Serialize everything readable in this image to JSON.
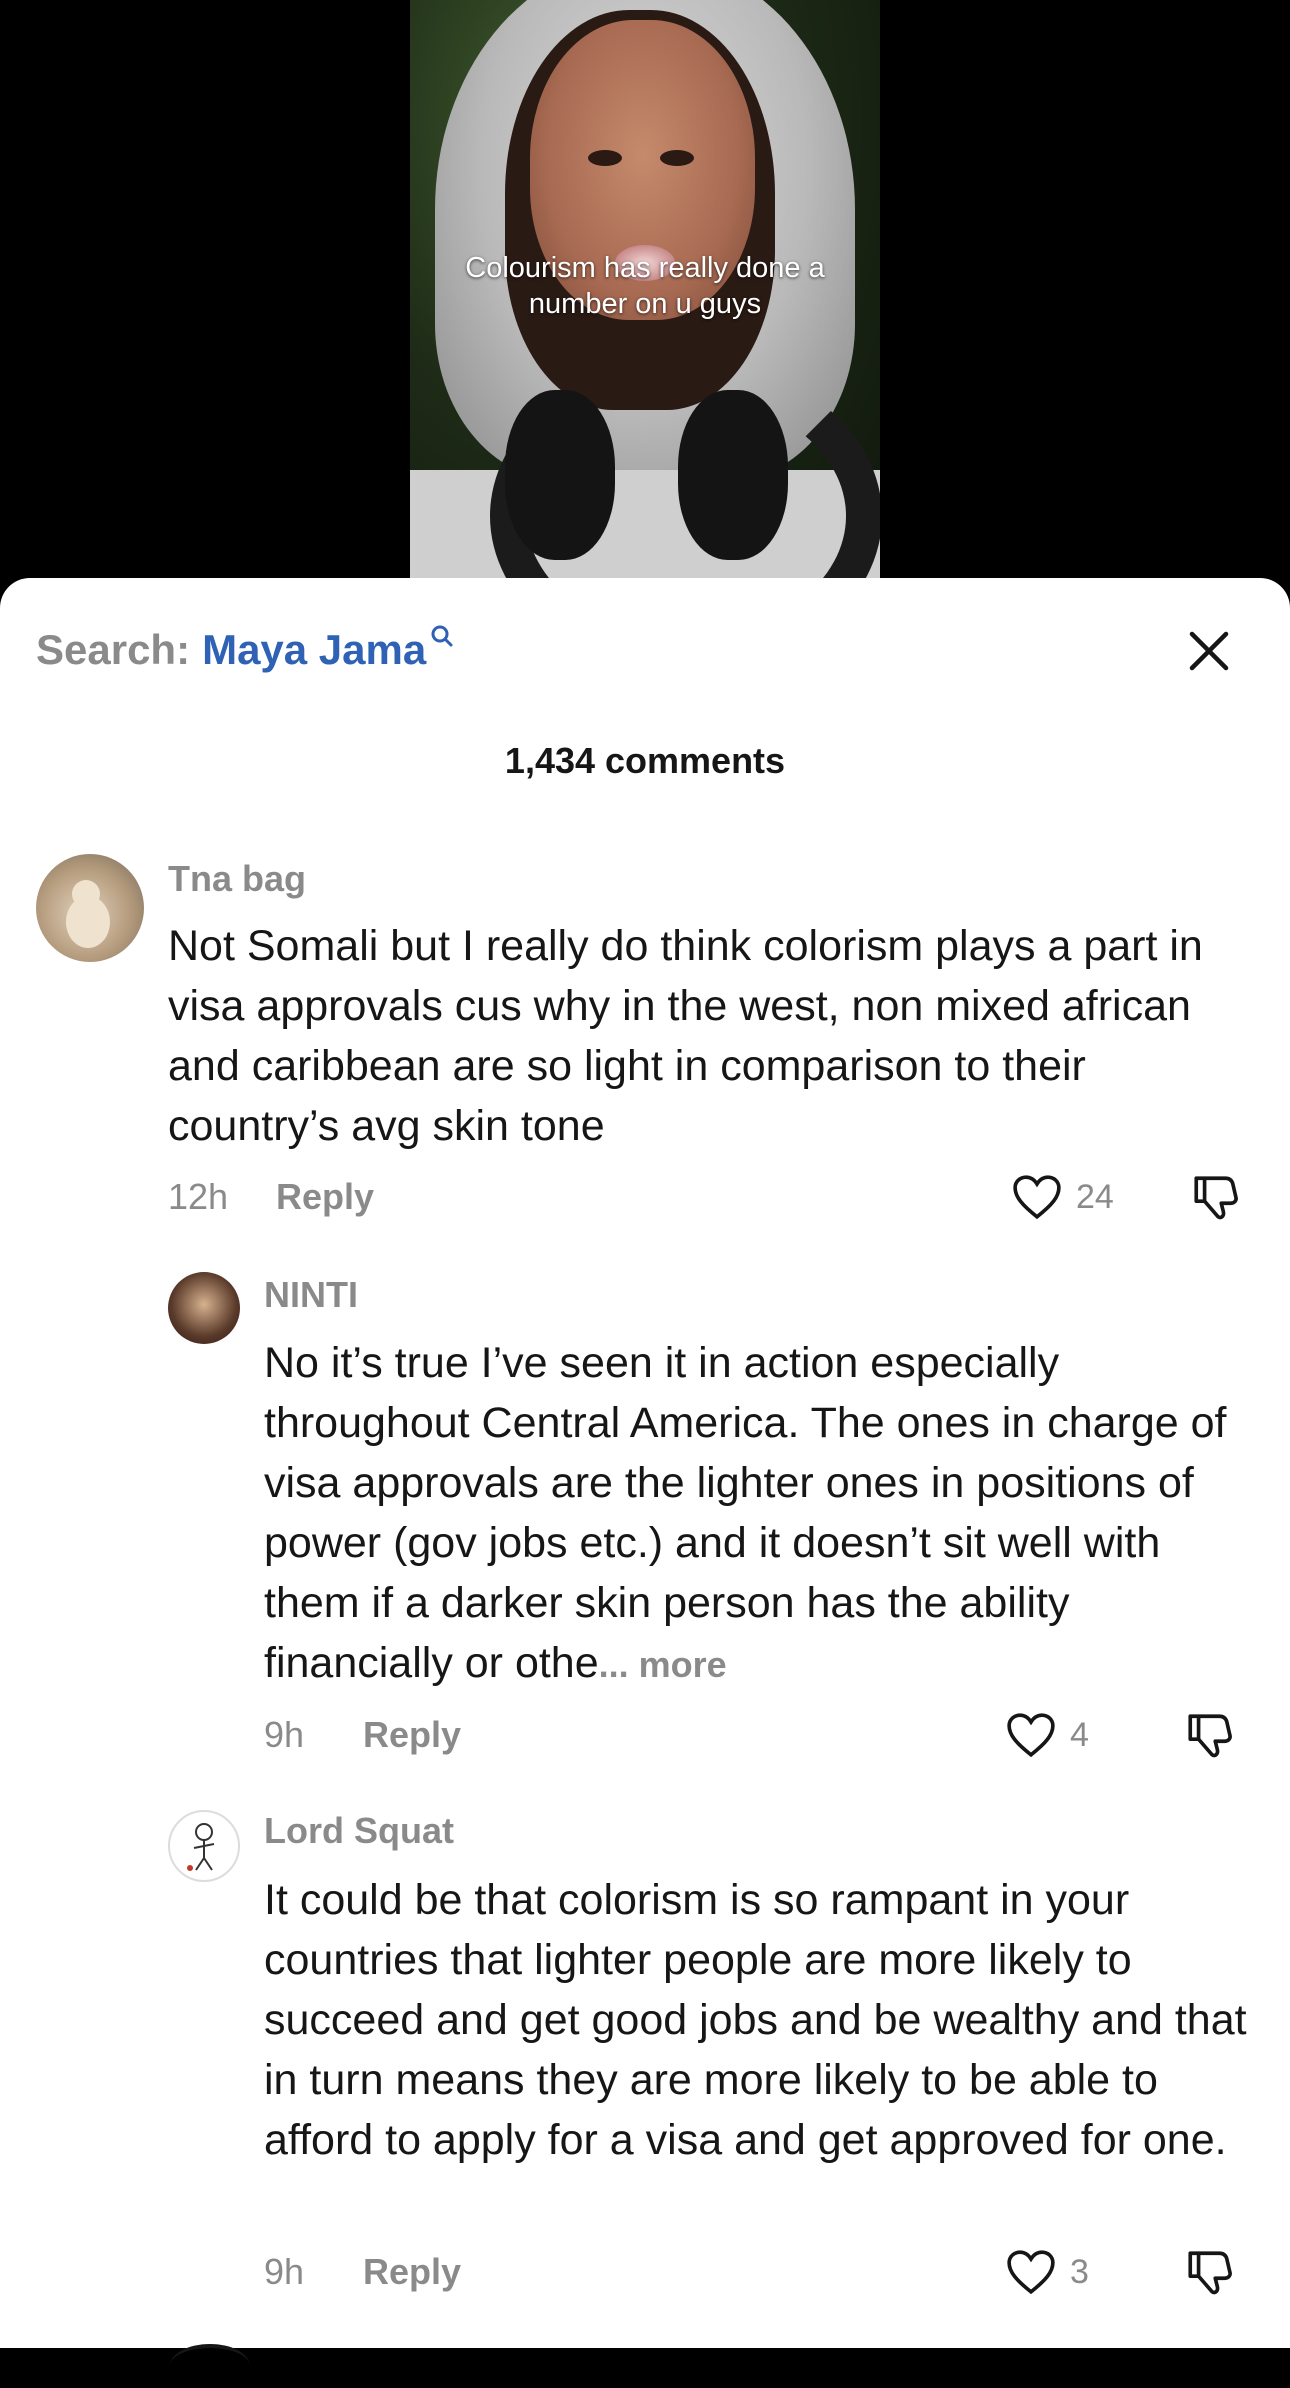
{
  "video": {
    "caption_line1": "Colourism has really done a",
    "caption_line2": "number on u guys"
  },
  "header": {
    "search_prefix": "Search:",
    "search_term": "Maya Jama",
    "search_icon": "search-icon",
    "close_icon": "close-icon",
    "comments_count": "1,434 comments"
  },
  "colors": {
    "search_link": "#2f62b4",
    "muted": "#8a8a8a",
    "text": "#161616"
  },
  "comments": [
    {
      "username": "Tna bag",
      "text": "Not Somali but I really do think colorism plays a part in visa approvals cus why in the west, non mixed african and caribbean are so light in comparison to their country’s avg skin tone",
      "time": "12h",
      "reply_label": "Reply",
      "likes": "24"
    },
    {
      "username": "NINTI",
      "text": "No it’s true I’ve seen it in action especially throughout Central America. The ones in charge of visa approvals are the lighter ones in positions of power (gov jobs etc.) and it doesn’t sit well with them if a darker skin person has the ability financially or othe",
      "more_label": "... more",
      "time": "9h",
      "reply_label": "Reply",
      "likes": "4"
    },
    {
      "username": "Lord Squat",
      "text": "It could be that colorism is so rampant in your countries that lighter people are more likely to succeed and get good jobs and be wealthy and that in turn means they are more likely to be able to afford to apply for a visa and get approved for one.",
      "time": "9h",
      "reply_label": "Reply",
      "likes": "3"
    }
  ]
}
